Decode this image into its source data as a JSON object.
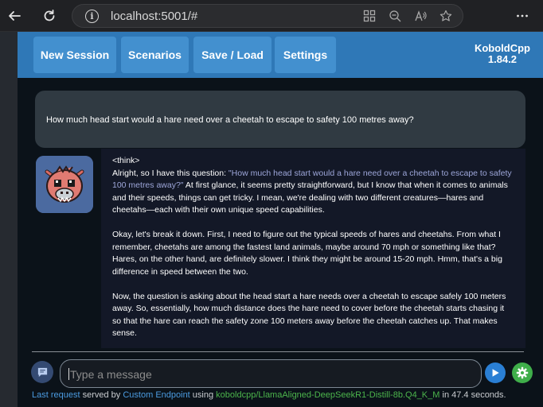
{
  "browser": {
    "url": "localhost:5001/#"
  },
  "topbar": {
    "buttons": [
      "New Session",
      "Scenarios",
      "Save / Load",
      "Settings"
    ],
    "brand_name": "KoboldCpp",
    "brand_version": "1.84.2"
  },
  "chat": {
    "user_message": "How much head start would a hare need over a cheetah to escape to safety 100 metres away?",
    "bot": {
      "think_tag": "<think>",
      "para1_start": "Alright, so I have this question: ",
      "para1_quote": "\"How much head start would a hare need over a cheetah to escape to safety 100 metres away?\"",
      "para1_end": " At first glance, it seems pretty straightforward, but I know that when it comes to animals and their speeds, things can get tricky. I mean, we're dealing with two different creatures—hares and cheetahs—each with their own unique speed capabilities.",
      "para2": "Okay, let's break it down. First, I need to figure out the typical speeds of hares and cheetahs. From what I remember, cheetahs are among the fastest land animals, maybe around 70 mph or something like that? Hares, on the other hand, are definitely slower. I think they might be around 15-20 mph. Hmm, that's a big difference in speed between the two.",
      "para3": "Now, the question is asking about the head start a hare needs over a cheetah to escape safely 100 meters away. So, essentially, how much distance does the hare need to cover before the cheetah starts chasing it so that the hare can reach the safety zone 100 meters away before the cheetah catches up. That makes sense."
    }
  },
  "input": {
    "placeholder": "Type a message"
  },
  "status": {
    "last_request": "Last request",
    "served_by": " served by ",
    "endpoint": "Custom Endpoint",
    "using": " using ",
    "model": "koboldcpp/LlamaAligned-DeepSeekR1-Distill-8b.Q4_K_M",
    "in_text": " in 47.4 seconds."
  },
  "colors": {
    "topbar": "#2f78b7",
    "button": "#4390cf",
    "send": "#2a7fd4",
    "settings": "#3fae4a",
    "quote": "#9da6d9"
  },
  "icons": [
    "back-arrow-icon",
    "refresh-icon",
    "info-icon",
    "app-grid-icon",
    "zoom-out-icon",
    "read-aloud-icon",
    "favorite-star-icon",
    "more-icon",
    "chat-bubble-icon",
    "send-icon",
    "gear-icon"
  ]
}
